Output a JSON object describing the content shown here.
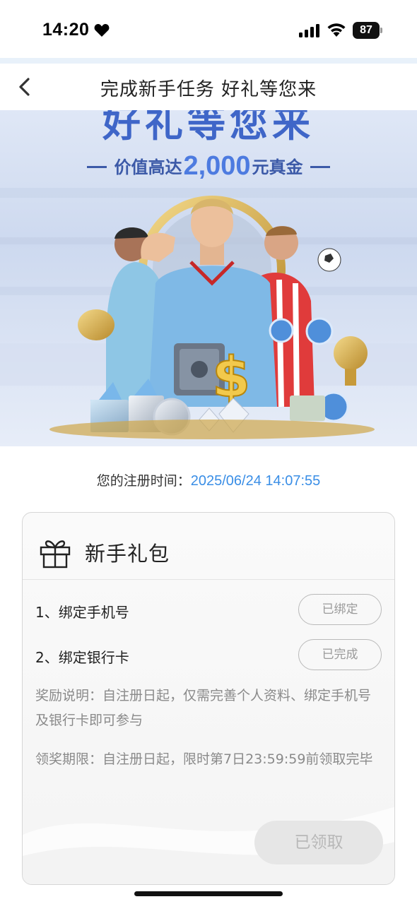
{
  "status_bar": {
    "time": "14:20",
    "battery": "87"
  },
  "nav": {
    "title": "完成新手任务 好礼等您来"
  },
  "banner": {
    "headline": "好礼等您来",
    "sub_prefix": "价值高达",
    "sub_amount": "2,000",
    "sub_suffix": "元真金"
  },
  "registration": {
    "label": "您的注册时间：",
    "time": "2025/06/24 14:07:55"
  },
  "gift_pack": {
    "title": "新手礼包",
    "tasks": [
      {
        "label": "1、绑定手机号",
        "status": "已绑定"
      },
      {
        "label": "2、绑定银行卡",
        "status": "已完成"
      }
    ],
    "reward_desc": "奖励说明：自注册日起，仅需完善个人资料、绑定手机号及银行卡即可参与",
    "claim_period": "领奖期限：自注册日起，限时第7日23:59:59前领取完毕",
    "claim_button": "已领取"
  },
  "colors": {
    "accent": "#3a8ee6",
    "banner_title": "#3f66c8"
  }
}
